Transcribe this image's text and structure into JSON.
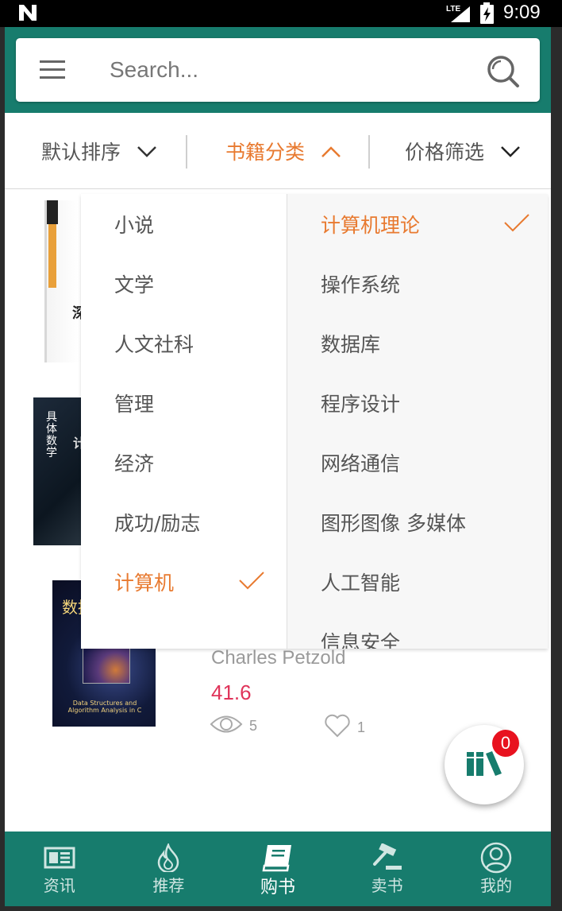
{
  "status_bar": {
    "time": "9:09",
    "network": "LTE"
  },
  "search": {
    "placeholder": "Search..."
  },
  "filters": {
    "sort": "默认排序",
    "category": "书籍分类",
    "price": "价格筛选"
  },
  "category_menu": {
    "primary": [
      "小说",
      "文学",
      "人文社科",
      "管理",
      "经济",
      "成功/励志",
      "计算机"
    ],
    "primary_selected": "计算机",
    "secondary": [
      "计算机理论",
      "操作系统",
      "数据库",
      "程序设计",
      "网络通信",
      "图形图像 多媒体",
      "人工智能",
      "信息安全"
    ],
    "secondary_selected": "计算机理论"
  },
  "books": [
    {
      "cover_text": "深"
    },
    {
      "cover_text": "具体数学",
      "cover_text2": "计"
    },
    {
      "cover_text": "数据结",
      "cover_subtitle": "Data Structures and Algorithm Analysis in C"
    }
  ],
  "book_details": {
    "author": "Charles Petzold",
    "price": "41.6",
    "views": "5",
    "likes": "1"
  },
  "cart_badge": "0",
  "bottom_nav": [
    {
      "label": "资讯",
      "icon": "newspaper-icon"
    },
    {
      "label": "推荐",
      "icon": "flame-icon"
    },
    {
      "label": "购书",
      "icon": "book-icon"
    },
    {
      "label": "卖书",
      "icon": "gavel-icon"
    },
    {
      "label": "我的",
      "icon": "user-icon"
    }
  ],
  "colors": {
    "primary": "#177c6d",
    "accent": "#e87a30",
    "price": "#e0345a",
    "badge": "#e8121f"
  }
}
